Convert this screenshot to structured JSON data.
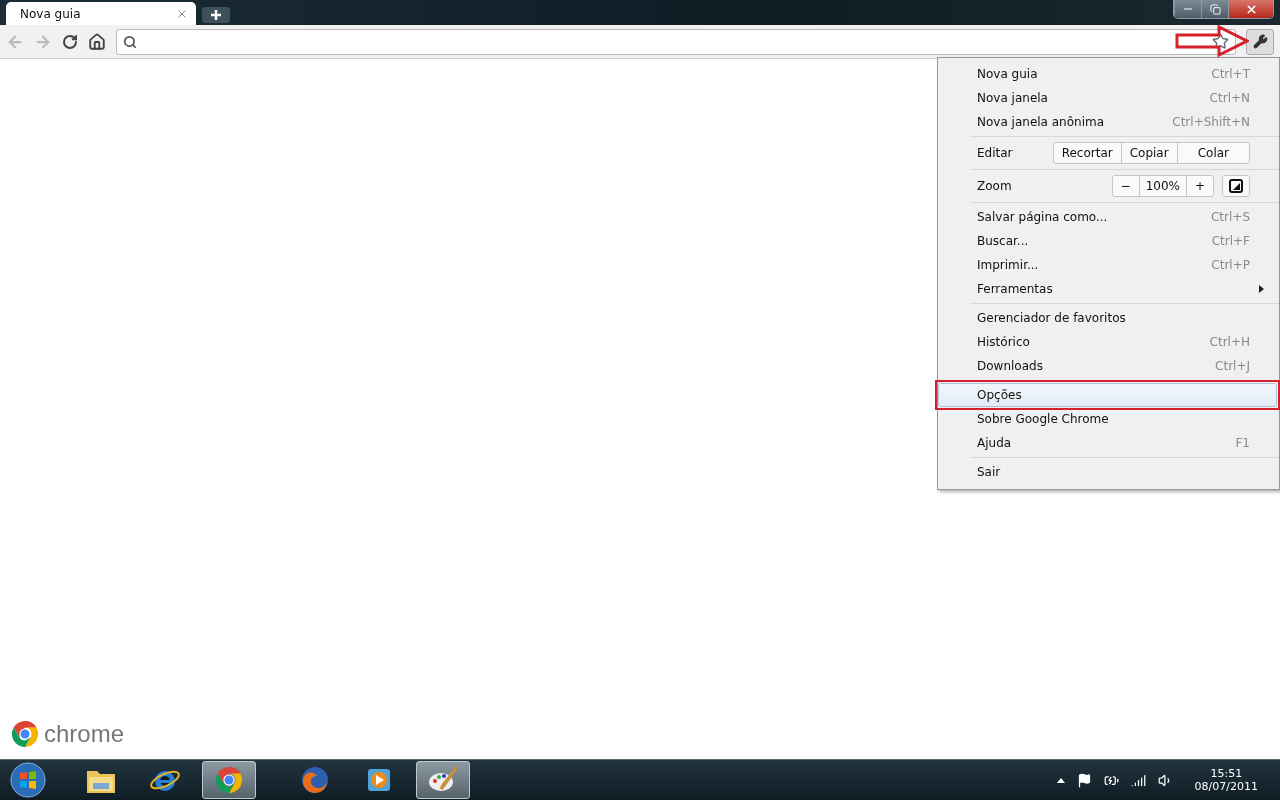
{
  "tab": {
    "title": "Nova guia",
    "selected": true
  },
  "menu": {
    "sections": [
      [
        {
          "kind": "item",
          "label": "Nova guia",
          "shortcut": "Ctrl+T",
          "selected": false
        },
        {
          "kind": "item",
          "label": "Nova janela",
          "shortcut": "Ctrl+N",
          "selected": false
        },
        {
          "kind": "item",
          "label": "Nova janela anônima",
          "shortcut": "Ctrl+Shift+N",
          "selected": false
        }
      ],
      [
        {
          "kind": "edit",
          "label": "Editar",
          "buttons": [
            "Recortar",
            "Copiar",
            "Colar"
          ]
        }
      ],
      [
        {
          "kind": "zoom",
          "label": "Zoom",
          "minus": "−",
          "value": "100%",
          "plus": "+"
        }
      ],
      [
        {
          "kind": "item",
          "label": "Salvar página como...",
          "shortcut": "Ctrl+S",
          "selected": false
        },
        {
          "kind": "item",
          "label": "Buscar...",
          "shortcut": "Ctrl+F",
          "selected": false
        },
        {
          "kind": "item",
          "label": "Imprimir...",
          "shortcut": "Ctrl+P",
          "selected": false
        },
        {
          "kind": "submenu",
          "label": "Ferramentas",
          "selected": false
        }
      ],
      [
        {
          "kind": "item",
          "label": "Gerenciador de favoritos",
          "selected": false
        },
        {
          "kind": "item",
          "label": "Histórico",
          "shortcut": "Ctrl+H",
          "selected": false
        },
        {
          "kind": "item",
          "label": "Downloads",
          "shortcut": "Ctrl+J",
          "selected": false
        }
      ],
      [
        {
          "kind": "item",
          "label": "Opções",
          "selected": true,
          "highlighted": true
        },
        {
          "kind": "item",
          "label": "Sobre Google Chrome",
          "selected": false
        },
        {
          "kind": "item",
          "label": "Ajuda",
          "shortcut": "F1",
          "selected": false
        }
      ],
      [
        {
          "kind": "item",
          "label": "Sair",
          "selected": false
        }
      ]
    ]
  },
  "logo": {
    "text": "chrome"
  },
  "taskbar": {
    "apps": [
      {
        "kind": "folder",
        "selected": false
      },
      {
        "kind": "ie",
        "selected": false
      },
      {
        "kind": "chrome",
        "selected": true
      },
      {
        "kind": "firefox",
        "selected": false
      },
      {
        "kind": "media",
        "selected": false
      },
      {
        "kind": "paint",
        "selected": true
      }
    ],
    "clock": {
      "time": "15:51",
      "date": "08/07/2011"
    }
  }
}
